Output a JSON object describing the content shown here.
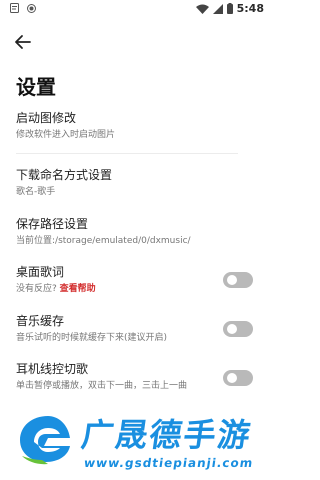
{
  "status_bar": {
    "time": "5:48",
    "left_icons": [
      "notification-icon",
      "record-icon"
    ],
    "right_icons": [
      "wifi-icon",
      "signal-icon",
      "battery-icon"
    ]
  },
  "header": {
    "back_icon": "arrow-left-icon",
    "title": "设置"
  },
  "settings": [
    {
      "title": "启动图修改",
      "subtitle": "修改软件进入时启动图片"
    },
    {
      "title": "下载命名方式设置",
      "subtitle": "歌名-歌手"
    },
    {
      "title": "保存路径设置",
      "subtitle": "当前位置:/storage/emulated/0/dxmusic/"
    },
    {
      "title": "桌面歌词",
      "subtitle": "没有反应?",
      "link": "查看帮助",
      "toggle": false
    },
    {
      "title": "音乐缓存",
      "subtitle": "音乐试听的时候就缓存下来(建议开启)",
      "toggle": false
    },
    {
      "title": "耳机线控切歌",
      "subtitle": "单击暂停或播放，双击下一曲，三击上一曲",
      "toggle": false
    }
  ],
  "watermark": {
    "brand": "广晟德手游",
    "url": "www.gsdtiepianji.com",
    "accent": "#1a8fe0"
  },
  "colors": {
    "link": "#d32f2f",
    "toggle_off": "#b9b9b9"
  }
}
